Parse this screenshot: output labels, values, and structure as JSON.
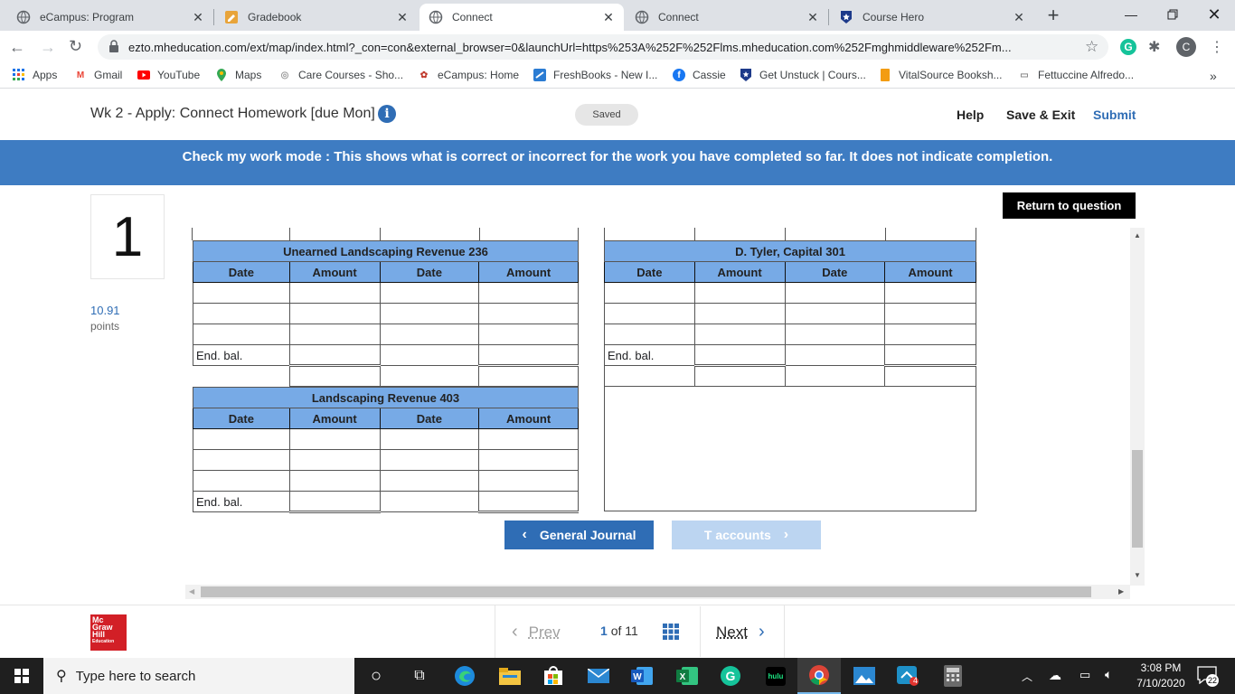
{
  "browser": {
    "tabs": [
      {
        "label": "eCampus: Program",
        "icon": "globe-icon"
      },
      {
        "label": "Gradebook",
        "icon": "gradebook-icon"
      },
      {
        "label": "Connect",
        "icon": "globe-icon",
        "active": true
      },
      {
        "label": "Connect",
        "icon": "globe-icon"
      },
      {
        "label": "Course Hero",
        "icon": "star-shield-icon"
      }
    ],
    "new_tab": "+",
    "url": "ezto.mheducation.com/ext/map/index.html?_con=con&external_browser=0&launchUrl=https%253A%252F%252Flms.mheducation.com%252Fmghmiddleware%252Fm...",
    "profile_initial": "C",
    "bookmarks": [
      {
        "label": "Apps",
        "icon": "apps-grid-icon"
      },
      {
        "label": "Gmail",
        "icon": "gmail-icon"
      },
      {
        "label": "YouTube",
        "icon": "youtube-icon"
      },
      {
        "label": "Maps",
        "icon": "maps-pin-icon"
      },
      {
        "label": "Care Courses - Sho...",
        "icon": "care-courses-icon"
      },
      {
        "label": "eCampus: Home",
        "icon": "ecampus-icon"
      },
      {
        "label": "FreshBooks - New I...",
        "icon": "freshbooks-icon"
      },
      {
        "label": "Cassie",
        "icon": "facebook-icon"
      },
      {
        "label": "Get Unstuck | Cours...",
        "icon": "course-hero-icon"
      },
      {
        "label": "VitalSource Booksh...",
        "icon": "vitalsource-icon"
      },
      {
        "label": "Fettuccine Alfredo...",
        "icon": "recipe-icon"
      }
    ],
    "more_bookmarks": "»"
  },
  "app": {
    "title": "Wk 2 - Apply: Connect Homework [due Mon]",
    "saved": "Saved",
    "help": "Help",
    "save_exit": "Save & Exit",
    "submit": "Submit",
    "banner": "Check my work mode : This shows what is correct or incorrect for the work you have completed so far. It does not indicate completion.",
    "return_btn": "Return to question",
    "question_number": "1",
    "points": "10.91",
    "points_label": "points"
  },
  "taccounts": {
    "columns": [
      "Date",
      "Amount",
      "Date",
      "Amount"
    ],
    "end_bal": "End. bal.",
    "accounts": [
      {
        "name": "Unearned Landscaping Revenue 236"
      },
      {
        "name": "D. Tyler, Capital 301"
      },
      {
        "name": "Landscaping Revenue 403"
      }
    ]
  },
  "nav": {
    "general_journal": "General Journal",
    "t_accounts": "T accounts",
    "prev": "Prev",
    "page_current": "1",
    "of": "of",
    "page_total": "11",
    "next": "Next",
    "logo_lines": [
      "Mc",
      "Graw",
      "Hill",
      "Education"
    ]
  },
  "taskbar": {
    "search_placeholder": "Type here to search",
    "time": "3:08 PM",
    "date": "7/10/2020",
    "notifications": "22",
    "hulu": "hulu",
    "badge": "4"
  }
}
